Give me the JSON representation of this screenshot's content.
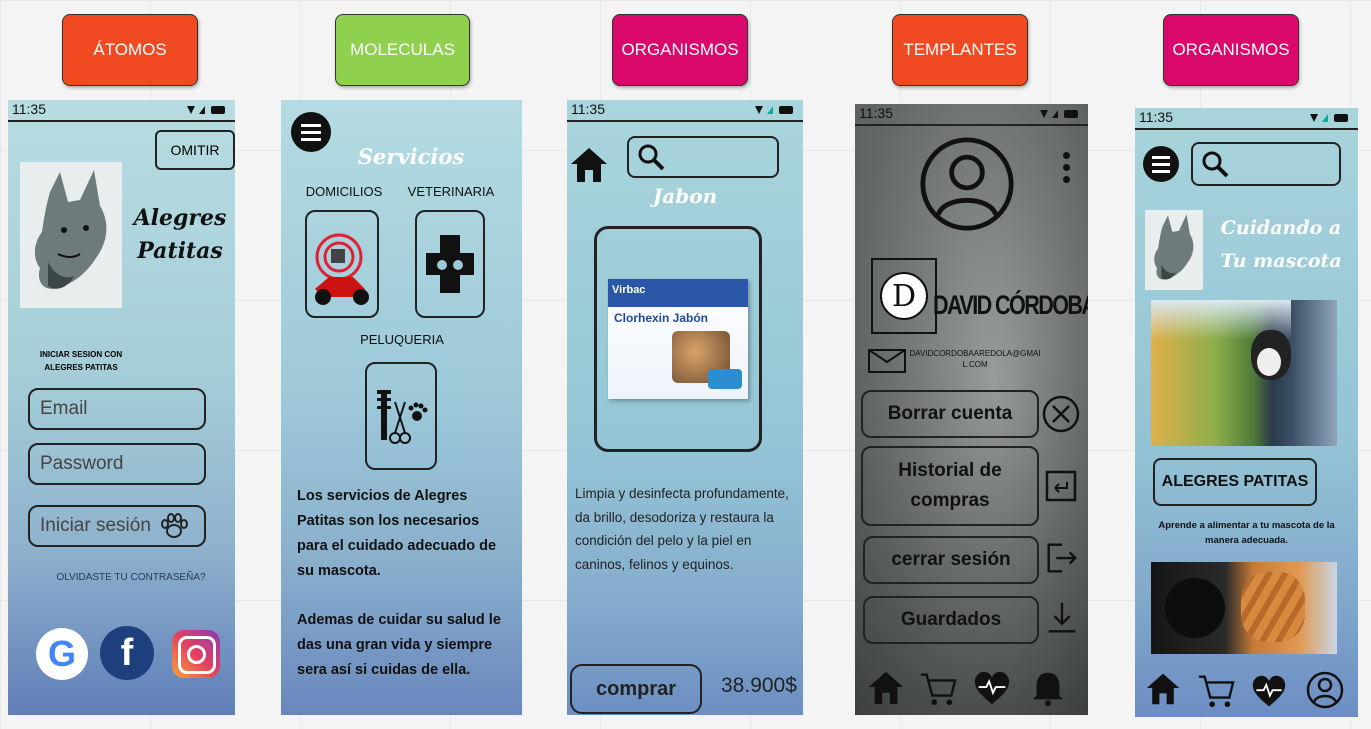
{
  "labels": [
    "ÁTOMOS",
    "MOLECULAS",
    "ORGANISMOS",
    "TEMPLANTES",
    "ORGANISMOS"
  ],
  "label_colors": [
    "#f14a23",
    "#8fd14f",
    "#d9086a",
    "#f14a23",
    "#d9086a"
  ],
  "status_time": "11:35",
  "atomos": {
    "skip": "OMITIR",
    "brand_line1": "Alegres",
    "brand_line2": "Patitas",
    "login_line1": "INICIAR SESION CON",
    "login_line2": "ALEGRES PATITAS",
    "email_placeholder": "Email",
    "password_placeholder": "Password",
    "login_button": "Iniciar sesión",
    "forgot": "OLVIDASTE TU CONTRASEÑA?",
    "social": [
      "google-icon",
      "facebook-icon",
      "instagram-icon"
    ]
  },
  "moleculas": {
    "title": "Servicios",
    "service1": "DOMICILIOS",
    "service2": "VETERINARIA",
    "service3": "PELUQUERIA",
    "p1": "Los servicios de Alegres Patitas son los necesarios para el cuidado adecuado de su mascota.",
    "p2": "Ademas de cuidar su salud le das una gran vida y siempre sera así si cuidas de ella."
  },
  "organismos": {
    "product_title": "Jabon",
    "box_brand": "Virbac",
    "box_name": "Clorhexin Jabón",
    "description": "Limpia y desinfecta profundamente, da brillo, desodoriza y restaura la condición del pelo y la piel en caninos, felinos y equinos.",
    "buy_button": "comprar",
    "price": "38.900$"
  },
  "templantes": {
    "initial": "D",
    "name": "DAVID CÓRDOBA",
    "email": "DAVIDCORDOBAAREDOLA@GMAIL.COM",
    "delete": "Borrar cuenta",
    "history_line1": "Historial de",
    "history_line2": "compras",
    "logout": "cerrar sesión",
    "saved": "Guardados"
  },
  "organismos2": {
    "headline1": "Cuidando a",
    "headline2": "Tu mascota",
    "brand_button": "ALEGRES PATITAS",
    "tag_line1": "Aprende a alimentar a tu mascota de la",
    "tag_line2": "manera adecuada."
  }
}
